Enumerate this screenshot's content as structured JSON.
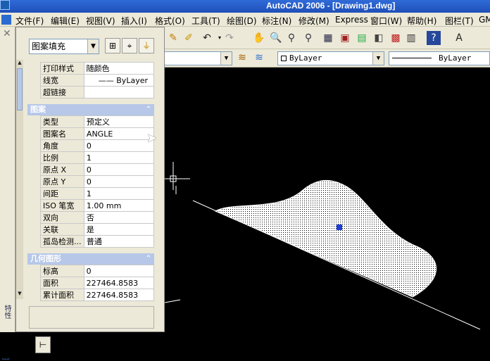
{
  "window": {
    "title": "AutoCAD 2006 - [Drawing1.dwg]"
  },
  "menu": [
    "文件(F)",
    "编辑(E)",
    "视图(V)",
    "插入(I)",
    "格式(O)",
    "工具(T)",
    "绘图(D)",
    "标注(N)",
    "修改(M)",
    "Express",
    "窗口(W)",
    "帮助(H)",
    "图栏(T)",
    "GM"
  ],
  "layer_toolbar": {
    "color_value": "ByLayer",
    "linetype_value": "ByLayer"
  },
  "palette": {
    "object_type": "图案填充",
    "side_label": "特性",
    "top_rows": [
      {
        "key": "打印样式",
        "value": "随颜色"
      },
      {
        "key": "线宽",
        "value": "—— ByLayer"
      },
      {
        "key": "超链接",
        "value": ""
      }
    ],
    "pattern_section": "图案",
    "pattern_rows": [
      {
        "key": "类型",
        "value": "预定义"
      },
      {
        "key": "图案名",
        "value": "ANGLE"
      },
      {
        "key": "角度",
        "value": "0"
      },
      {
        "key": "比例",
        "value": "1"
      },
      {
        "key": "原点 X",
        "value": "0"
      },
      {
        "key": "原点 Y",
        "value": "0"
      },
      {
        "key": "间距",
        "value": "1"
      },
      {
        "key": "ISO 笔宽",
        "value": "1.00 mm"
      },
      {
        "key": "双向",
        "value": "否"
      },
      {
        "key": "关联",
        "value": "是"
      },
      {
        "key": "孤岛检测...",
        "value": "普通"
      }
    ],
    "geometry_section": "几何图形",
    "geometry_rows": [
      {
        "key": "标高",
        "value": "0"
      },
      {
        "key": "面积",
        "value": "227464.8583"
      },
      {
        "key": "累计面积",
        "value": "227464.8583"
      }
    ]
  }
}
